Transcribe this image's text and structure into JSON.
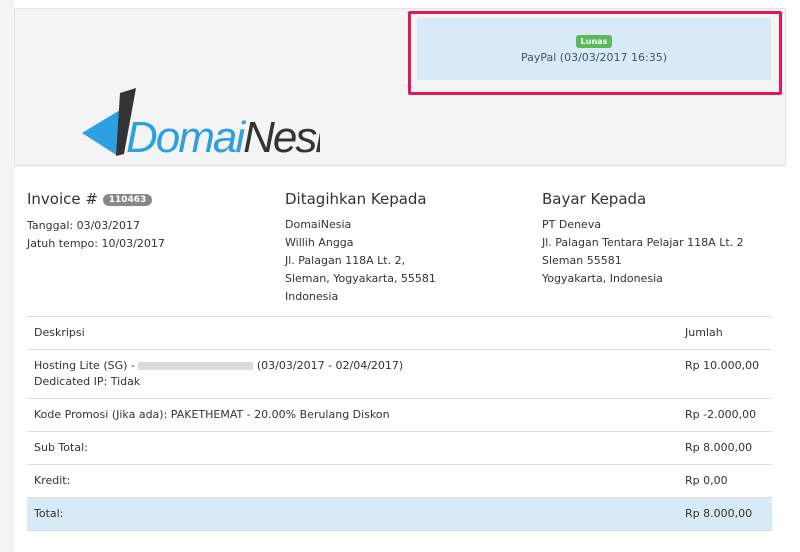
{
  "payment": {
    "status": "Lunas",
    "method": "PayPal (03/03/2017 16:35)",
    "status_color": "#5cb85c",
    "highlight_color": "#e0195f"
  },
  "logo": {
    "text_a": "Domai",
    "text_b": "Nesia"
  },
  "invoice": {
    "label": "Invoice #",
    "number": "110463",
    "date": "Tanggal: 03/03/2017",
    "due": "Jatuh tempo: 10/03/2017"
  },
  "billed_to": {
    "title": "Ditagihkan Kepada",
    "lines": [
      "DomaiNesia",
      "Willih Angga",
      "Jl. Palagan 118A Lt. 2,",
      "Sleman, Yogyakarta, 55581",
      "Indonesia"
    ]
  },
  "pay_to": {
    "title": "Bayar Kepada",
    "lines": [
      "PT Deneva",
      "Jl. Palagan Tentara Pelajar 118A Lt. 2",
      "Sleman 55581",
      "Yogyakarta, Indonesia"
    ]
  },
  "table": {
    "headers": [
      "Deskripsi",
      "Jumlah"
    ],
    "rows": [
      {
        "desc": "Hosting Lite (SG) -",
        "desc_tail": "(03/03/2017 - 02/04/2017)",
        "desc2": "Dedicated IP: Tidak",
        "amount": "Rp 10.000,00"
      },
      {
        "desc": "Kode Promosi (Jika ada): PAKETHEMAT - 20.00% Berulang Diskon",
        "amount": "Rp -2.000,00"
      },
      {
        "desc": "Sub Total:",
        "amount": "Rp 8.000,00"
      },
      {
        "desc": "Kredit:",
        "amount": "Rp 0,00"
      },
      {
        "desc": "Total:",
        "amount": "Rp 8.000,00"
      }
    ]
  }
}
